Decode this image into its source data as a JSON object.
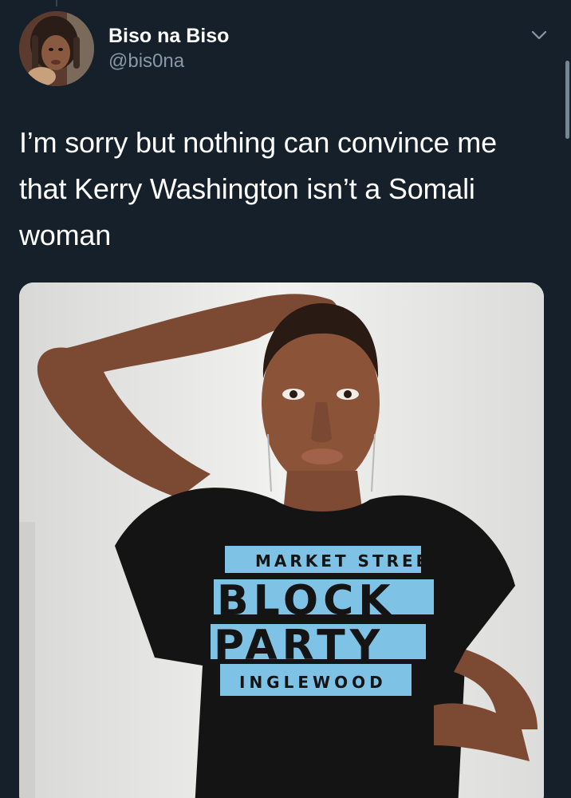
{
  "tweet": {
    "author": {
      "display_name": "Biso na Biso",
      "handle": "@bis0na",
      "avatar": "profile-photo"
    },
    "text": "I’m sorry but nothing can convince me that Kerry Washington isn’t a Somali woman",
    "more_icon": "chevron-down-icon",
    "media": {
      "type": "photo",
      "shirt_text": {
        "line1": "MARKET STREET",
        "line2": "BLOCK",
        "line3": "PARTY",
        "line4": "INGLEWOOD"
      },
      "colors": {
        "shirt": "#141414",
        "print": "#7ec3e6",
        "wall": "#e9e9e7"
      }
    }
  },
  "theme": {
    "background": "#15202b",
    "text": "#ffffff",
    "secondary_text": "#8899a6"
  }
}
